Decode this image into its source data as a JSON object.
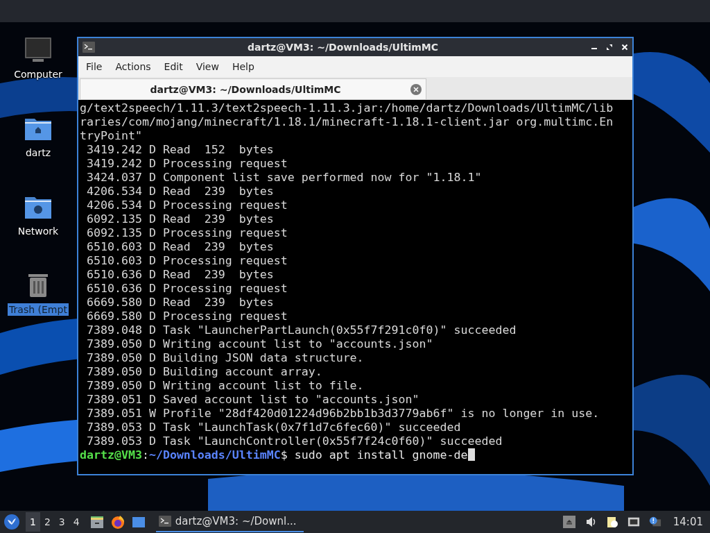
{
  "desktop_icons": [
    {
      "label": "Computer",
      "kind": "computer",
      "selected": false
    },
    {
      "label": "dartz",
      "kind": "home",
      "selected": false
    },
    {
      "label": "Network",
      "kind": "network",
      "selected": false
    },
    {
      "label": "Trash (Empt",
      "kind": "trash",
      "selected": true
    }
  ],
  "window": {
    "title": "dartz@VM3: ~/Downloads/UltimMC",
    "menu": [
      "File",
      "Actions",
      "Edit",
      "View",
      "Help"
    ],
    "tab": {
      "label": "dartz@VM3: ~/Downloads/UltimMC"
    },
    "terminal": {
      "lines": [
        "g/text2speech/1.11.3/text2speech-1.11.3.jar:/home/dartz/Downloads/UltimMC/lib",
        "raries/com/mojang/minecraft/1.18.1/minecraft-1.18.1-client.jar org.multimc.En",
        "tryPoint\"",
        " 3419.242 D Read  152  bytes",
        " 3419.242 D Processing request",
        " 3424.037 D Component list save performed now for \"1.18.1\"",
        " 4206.534 D Read  239  bytes",
        " 4206.534 D Processing request",
        " 6092.135 D Read  239  bytes",
        " 6092.135 D Processing request",
        " 6510.603 D Read  239  bytes",
        " 6510.603 D Processing request",
        " 6510.636 D Read  239  bytes",
        " 6510.636 D Processing request",
        " 6669.580 D Read  239  bytes",
        " 6669.580 D Processing request",
        " 7389.048 D Task \"LauncherPartLaunch(0x55f7f291c0f0)\" succeeded",
        " 7389.050 D Writing account list to \"accounts.json\"",
        " 7389.050 D Building JSON data structure.",
        " 7389.050 D Building account array.",
        " 7389.050 D Writing account list to file.",
        " 7389.051 D Saved account list to \"accounts.json\"",
        " 7389.051 W Profile \"28df420d01224d96b2bb1b3d3779ab6f\" is no longer in use.",
        " 7389.053 D Task \"LaunchTask(0x7f1d7c6fec60)\" succeeded",
        " 7389.053 D Task \"LaunchController(0x55f7f24c0f60)\" succeeded"
      ],
      "prompt": {
        "user_host": "dartz@VM3",
        "separator": ":",
        "path": "~/Downloads/UltimMC",
        "symbol": "$",
        "command": "sudo apt install gnome-de"
      }
    }
  },
  "taskbar": {
    "workspaces": [
      {
        "label": "1",
        "selected": true
      },
      {
        "label": "2",
        "selected": false
      },
      {
        "label": "3",
        "selected": false
      },
      {
        "label": "4",
        "selected": false
      }
    ],
    "launchers": [
      {
        "kind": "files"
      },
      {
        "kind": "browser"
      },
      {
        "kind": "desktop"
      }
    ],
    "task": {
      "label": "dartz@VM3: ~/Downl..."
    },
    "tray": [
      {
        "kind": "eject"
      },
      {
        "kind": "volume"
      },
      {
        "kind": "clipboard"
      },
      {
        "kind": "network"
      },
      {
        "kind": "notification"
      }
    ],
    "clock": "14:01"
  }
}
